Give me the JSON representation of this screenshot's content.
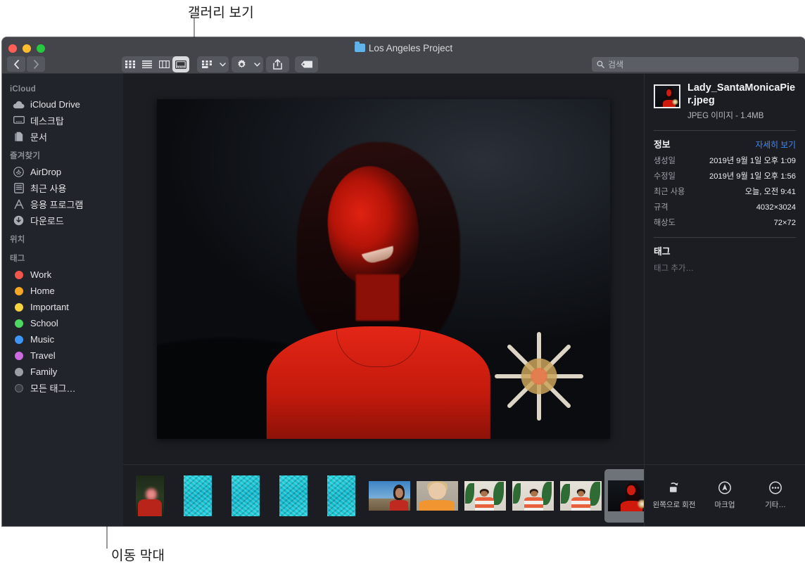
{
  "callouts": {
    "gallery_view": "갤러리 보기",
    "scrubber": "이동 막대"
  },
  "window": {
    "title": "Los Angeles Project",
    "folder_icon": "folder-icon"
  },
  "toolbar": {
    "back": "back-icon",
    "forward": "forward-icon",
    "view_icon_label": "icon-view-icon",
    "view_list_label": "list-view-icon",
    "view_column_label": "column-view-icon",
    "view_gallery_label": "gallery-view-icon",
    "group_label": "group-by-icon",
    "action_label": "gear-icon",
    "share_label": "share-icon",
    "tag_label": "tag-icon"
  },
  "search": {
    "placeholder": "검색",
    "value": ""
  },
  "sidebar": {
    "sections": [
      {
        "header": "iCloud",
        "items": [
          {
            "label": "iCloud Drive",
            "icon": "cloud-icon"
          },
          {
            "label": "데스크탑",
            "icon": "desktop-icon"
          },
          {
            "label": "문서",
            "icon": "documents-icon"
          }
        ]
      },
      {
        "header": "즐겨찾기",
        "items": [
          {
            "label": "AirDrop",
            "icon": "airdrop-icon"
          },
          {
            "label": "최근 사용",
            "icon": "recents-icon"
          },
          {
            "label": "응용 프로그램",
            "icon": "applications-icon"
          },
          {
            "label": "다운로드",
            "icon": "downloads-icon"
          }
        ]
      },
      {
        "header": "위치",
        "items": []
      },
      {
        "header": "태그",
        "items": [
          {
            "label": "Work",
            "icon": "tag-dot",
            "color": "#f0564a"
          },
          {
            "label": "Home",
            "icon": "tag-dot",
            "color": "#f5a623"
          },
          {
            "label": "Important",
            "icon": "tag-dot",
            "color": "#f7d340"
          },
          {
            "label": "School",
            "icon": "tag-dot",
            "color": "#4cd963"
          },
          {
            "label": "Music",
            "icon": "tag-dot",
            "color": "#3d95f5"
          },
          {
            "label": "Travel",
            "icon": "tag-dot",
            "color": "#cc6ae0"
          },
          {
            "label": "Family",
            "icon": "tag-dot",
            "color": "#9b9ea4"
          },
          {
            "label": "모든 태그…",
            "icon": "all-tags-icon",
            "color": ""
          }
        ]
      }
    ]
  },
  "info": {
    "filename": "Lady_SantaMonicaPier.jpeg",
    "kind_size": "JPEG 이미지 - 1.4MB",
    "section_info_title": "정보",
    "more_link": "자세히 보기",
    "rows": [
      {
        "key": "생성일",
        "value": "2019년 9월 1일 오후 1:09"
      },
      {
        "key": "수정일",
        "value": "2019년 9월 1일 오후 1:56"
      },
      {
        "key": "최근 사용",
        "value": "오늘, 오전 9:41"
      },
      {
        "key": "규격",
        "value": "4032×3024"
      },
      {
        "key": "해상도",
        "value": "72×72"
      }
    ],
    "section_tags_title": "태그",
    "tag_placeholder": "태그 추가…"
  },
  "actions": [
    {
      "label": "왼쪽으로 회전",
      "icon": "rotate-left-icon"
    },
    {
      "label": "마크업",
      "icon": "markup-icon"
    },
    {
      "label": "기타…",
      "icon": "more-icon"
    }
  ],
  "filmstrip": {
    "thumbnails": [
      {
        "kind": "blurred-face-portrait",
        "selected": false
      },
      {
        "kind": "pool-diver",
        "selected": false
      },
      {
        "kind": "pool-diver",
        "selected": false
      },
      {
        "kind": "pool-diver",
        "selected": false
      },
      {
        "kind": "pool-diver",
        "selected": false
      },
      {
        "kind": "woman-red-sky",
        "selected": false
      },
      {
        "kind": "blonde-orange",
        "selected": false
      },
      {
        "kind": "man-plants",
        "selected": false
      },
      {
        "kind": "man-plants",
        "selected": false
      },
      {
        "kind": "man-plants",
        "selected": false
      },
      {
        "kind": "night-red-portrait",
        "selected": true
      }
    ]
  },
  "colors": {
    "accent_link": "#3d8bfd",
    "toolbar_bg": "#43454a",
    "sidebar_bg": "#22242b",
    "content_bg": "#1b1d23",
    "selection": "#6e7279"
  }
}
